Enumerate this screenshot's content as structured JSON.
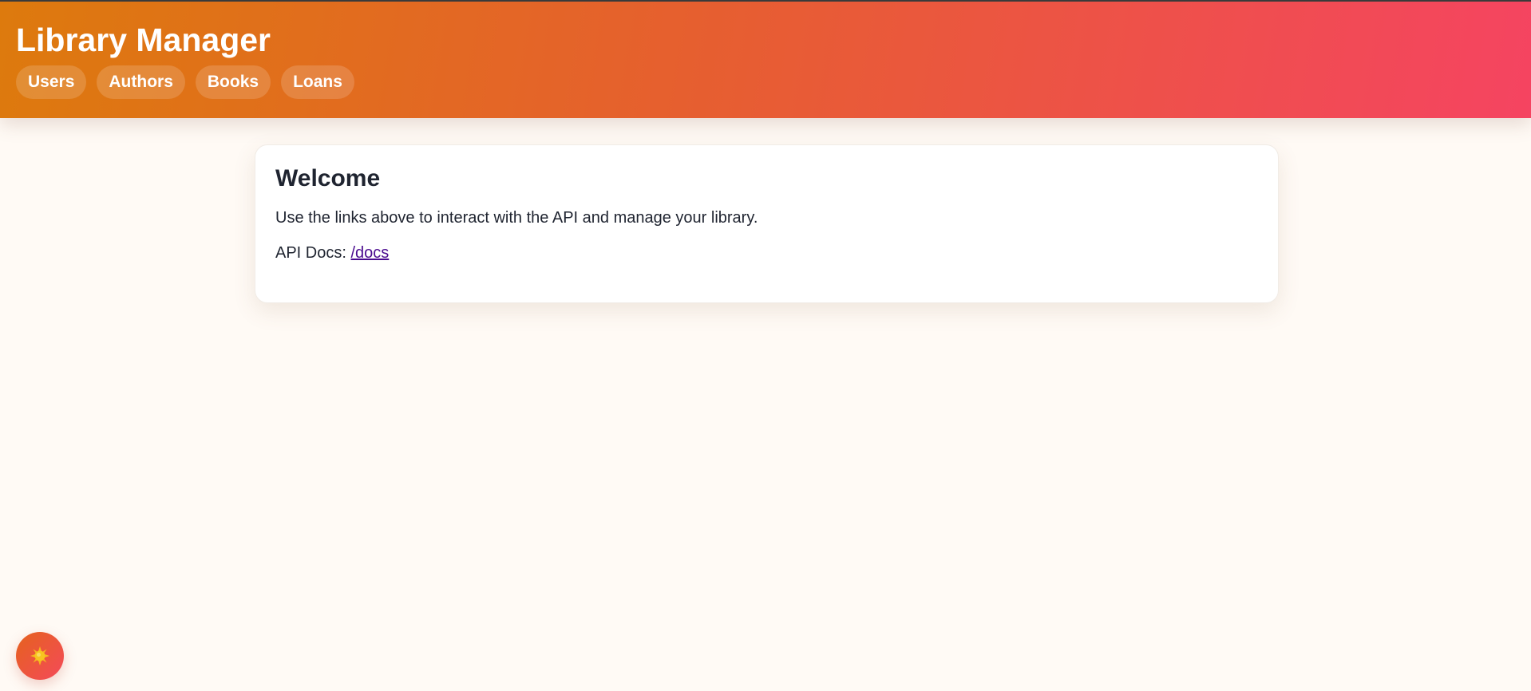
{
  "app": {
    "title": "Library Manager"
  },
  "nav": {
    "items": [
      {
        "label": "Users"
      },
      {
        "label": "Authors"
      },
      {
        "label": "Books"
      },
      {
        "label": "Loans"
      }
    ]
  },
  "welcome": {
    "title": "Welcome",
    "text": "Use the links above to interact with the API and manage your library.",
    "docs_label": "API Docs: ",
    "docs_link": "/docs"
  },
  "theme_toggle": {
    "icon": "sun-icon"
  },
  "colors": {
    "header_start": "#dd7a0d",
    "header_end": "#f54461",
    "page_background": "#fffaf5",
    "link": "#4a0b8f"
  }
}
